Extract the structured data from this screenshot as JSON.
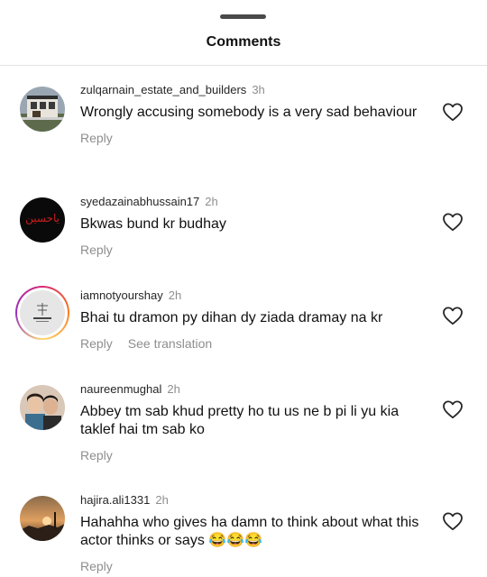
{
  "header": {
    "title": "Comments"
  },
  "comments": [
    {
      "username": "zulqarnain_estate_and_builders",
      "time": "3h",
      "text": "Wrongly accusing somebody is  a very  sad behaviour",
      "reply": "Reply",
      "translate": ""
    },
    {
      "username": "syedazainabhussain17",
      "time": "2h",
      "text": "Bkwas bund kr budhay",
      "reply": "Reply",
      "translate": "",
      "avatar_text": "یاحسین"
    },
    {
      "username": "iamnotyourshay",
      "time": "2h",
      "text": "Bhai tu dramon py dihan dy ziada dramay na kr",
      "reply": "Reply",
      "translate": "See translation"
    },
    {
      "username": "naureenmughal",
      "time": "2h",
      "text": "Abbey tm sab khud pretty ho tu us ne b pi li yu kia taklef hai tm sab ko",
      "reply": "Reply",
      "translate": ""
    },
    {
      "username": "hajira.ali1331",
      "time": "2h",
      "text": "Hahahha who gives ha damn to think about what this actor thinks or says 😂😂😂",
      "reply": "Reply",
      "translate": ""
    }
  ]
}
